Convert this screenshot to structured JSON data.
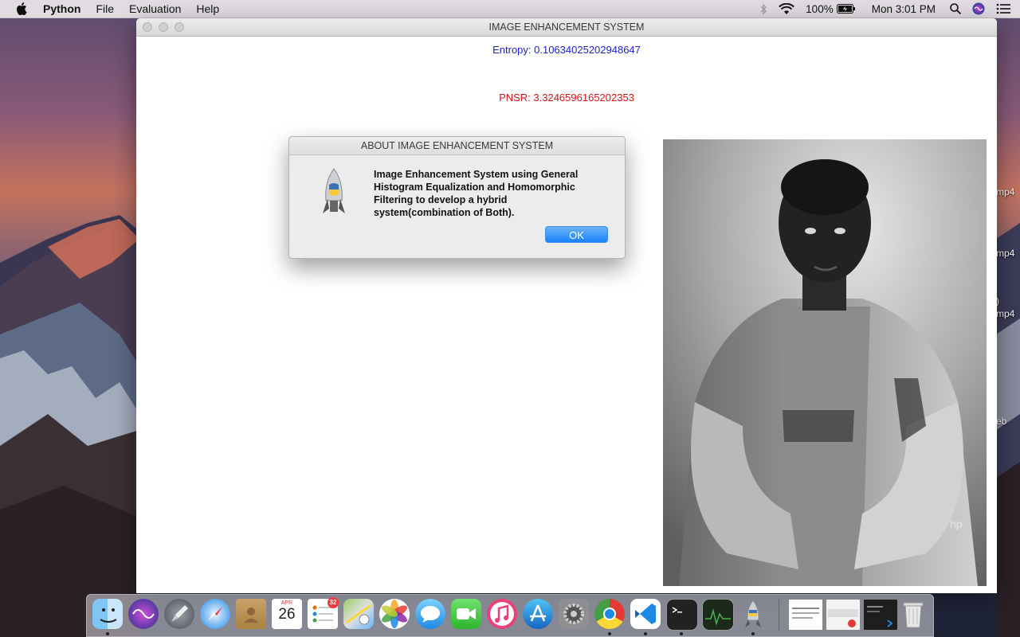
{
  "menubar": {
    "app_name": "Python",
    "items": [
      "File",
      "Evaluation",
      "Help"
    ],
    "battery": "100%",
    "clock": "Mon 3:01 PM"
  },
  "window": {
    "title": "IMAGE ENHANCEMENT SYSTEM",
    "entropy_text": "Entropy: 0.10634025202948647",
    "pnsr_text": "PNSR: 3.3246596165202353",
    "entropy_color": "#1e1ed2",
    "pnsr_color": "#e01010"
  },
  "dialog": {
    "title": "ABOUT IMAGE ENHANCEMENT SYSTEM",
    "message": "Image Enhancement System using General Histogram Equalization and Homomorphic Filtering to develop a hybrid system(combination of Both).",
    "ok_label": "OK",
    "icon": "python-launcher-icon"
  },
  "desktop_labels": [
    "mp4",
    "mp4",
    ")",
    "mp4",
    "eb"
  ],
  "dock": {
    "calendar_month": "APR",
    "calendar_day": "26",
    "reminders_badge": "32",
    "apps": [
      "finder",
      "siri",
      "launchpad",
      "safari",
      "contacts",
      "calendar",
      "reminders",
      "maps",
      "photos",
      "messages",
      "facetime",
      "itunes",
      "app-store",
      "system-preferences",
      "chrome",
      "vscode",
      "terminal",
      "activity-monitor",
      "python-launcher",
      "preview-window-1",
      "preview-window-2",
      "preview-window-3",
      "trash"
    ]
  }
}
